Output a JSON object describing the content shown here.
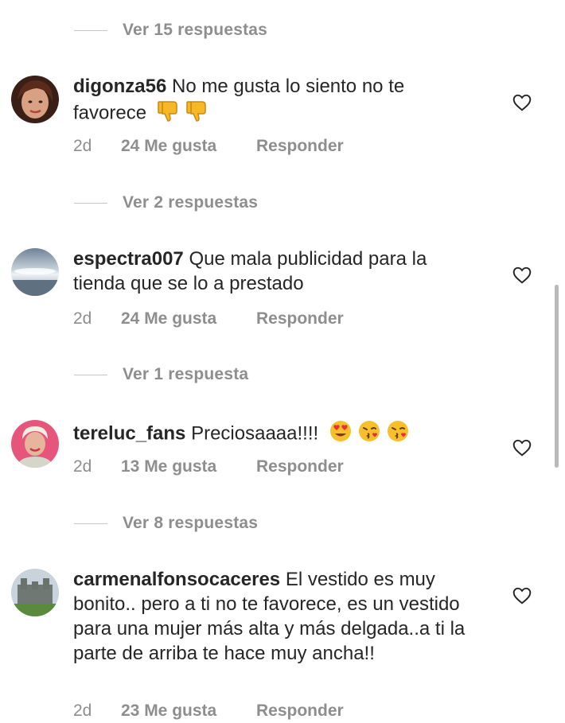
{
  "threads": [
    {
      "view_replies": "Ver 15 respuestas"
    },
    {
      "username": "digonza56",
      "text": "No me gusta lo siento no te favorece",
      "emojis": [
        "thumbs-down-emoji",
        "thumbs-down-emoji"
      ],
      "age": "2d",
      "likes": "24 Me gusta",
      "reply": "Responder",
      "view_replies": "Ver 2 respuestas"
    },
    {
      "username": "espectra007",
      "text": "Que mala publicidad para la tienda que se lo a prestado",
      "emojis": [],
      "age": "2d",
      "likes": "24 Me gusta",
      "reply": "Responder",
      "view_replies": "Ver 1 respuesta"
    },
    {
      "username": "tereluc_fans",
      "text": "Preciosaaaa!!!!",
      "emojis": [
        "heart-eyes-emoji",
        "kiss-emoji",
        "kiss-emoji"
      ],
      "age": "2d",
      "likes": "13 Me gusta",
      "reply": "Responder",
      "view_replies": "Ver 8 respuestas"
    },
    {
      "username": "carmenalfonsocaceres",
      "text": "El vestido es muy bonito.. pero a ti no te favorece, es un vestido para una mujer más alta y más delgada..a ti la parte de arriba te hace muy ancha!!",
      "emojis": [],
      "age": "2d",
      "likes": "23 Me gusta",
      "reply": "Responder"
    }
  ],
  "colors": {
    "text": "#262626",
    "muted": "#8e8e8e",
    "divider": "#c7c7c7"
  }
}
